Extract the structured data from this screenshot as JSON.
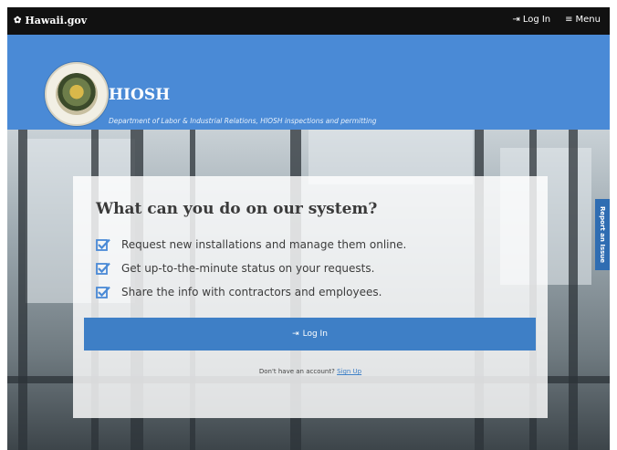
{
  "topbar": {
    "brand": "Hawaii.gov",
    "login": "Log In",
    "menu": "Menu"
  },
  "header": {
    "title": "HIOSH",
    "subtitle": "Department of Labor & Industrial Relations, HIOSH inspections and permitting"
  },
  "card": {
    "heading": "What can you do on our system?",
    "features": [
      "Request new installations and manage them online.",
      "Get up-to-the-minute status on your requests.",
      "Share the info with contractors and employees."
    ],
    "login_button": "Log In",
    "signup_prompt": "Don't have an account?",
    "signup_link": "Sign Up"
  },
  "side_tab": "Report an Issue",
  "colors": {
    "topbar": "#111111",
    "header": "#4a8ad6",
    "button": "#3e7fc6",
    "side_tab": "#2f6db2"
  }
}
